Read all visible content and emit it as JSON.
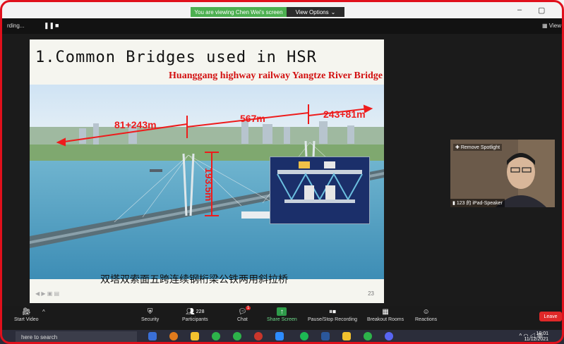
{
  "window": {
    "viewing_text": "You are viewing Chen Wei's screen",
    "view_options": "View Options",
    "minimize": "–",
    "restore": "▢"
  },
  "meeting": {
    "recording": "rding...",
    "view_label": "View"
  },
  "slide": {
    "title": "1.Common Bridges used in HSR",
    "subtitle": "Huanggang highway railway Yangtze River Bridge",
    "dim_left": "81+243m",
    "dim_mid": "567m",
    "dim_right": "243+81m",
    "dim_height": "193.5m",
    "caption": "双塔双索面五跨连续钢桁梁公铁两用斜拉桥",
    "page_number": "23"
  },
  "speaker": {
    "remove_spotlight": "Remove Spotlight",
    "label": "123 的 iPad-Speaker"
  },
  "toolbar": {
    "start_video": "Start Video",
    "security": "Security",
    "participants": "Participants",
    "participants_count": "228",
    "chat": "Chat",
    "chat_badge": "1",
    "share_screen": "Share Screen",
    "pause_recording": "Pause/Stop Recording",
    "breakout_rooms": "Breakout Rooms",
    "reactions": "Reactions",
    "leave": "Leave"
  },
  "taskbar": {
    "search_placeholder": "here to search",
    "time": "10:01",
    "date": "11/12/2021",
    "ime": "中"
  },
  "colors": {
    "frame_red": "#e0101c",
    "pill_green": "#4caf50",
    "leave_red": "#e02828",
    "dim_red": "#ee1c1c"
  }
}
